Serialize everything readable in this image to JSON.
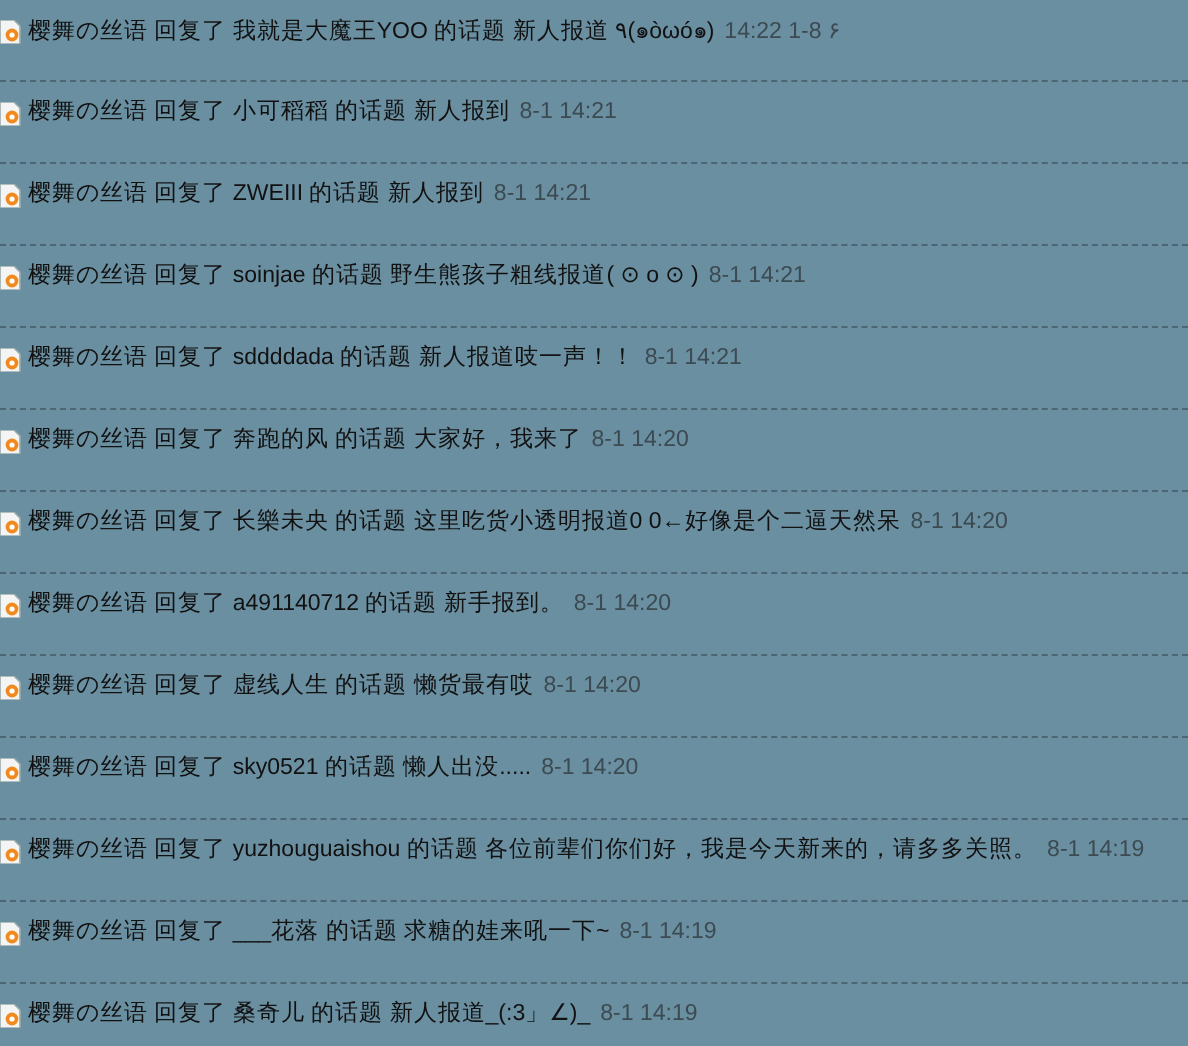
{
  "activities": [
    {
      "user": "樱舞の丝语",
      "verb": "回复了",
      "author": "我就是大魔王YOO",
      "of_topic": "的话题",
      "topic": "新人报道 ٩(๑òωó๑)",
      "time": "14:22 1-8 ۶"
    },
    {
      "user": "樱舞の丝语",
      "verb": "回复了",
      "author": "小可稻稻",
      "of_topic": "的话题",
      "topic": "新人报到",
      "time": "8-1 14:21"
    },
    {
      "user": "樱舞の丝语",
      "verb": "回复了",
      "author": "ZWEIII",
      "of_topic": "的话题",
      "topic": "新人报到",
      "time": "8-1 14:21"
    },
    {
      "user": "樱舞の丝语",
      "verb": "回复了",
      "author": "soinjae",
      "of_topic": "的话题",
      "topic": "野生熊孩子粗线报道( ⊙ o ⊙ )",
      "time": "8-1 14:21"
    },
    {
      "user": "樱舞の丝语",
      "verb": "回复了",
      "author": "sddddada",
      "of_topic": "的话题",
      "topic": "新人报道吱一声！！",
      "time": "8-1 14:21"
    },
    {
      "user": "樱舞の丝语",
      "verb": "回复了",
      "author": "奔跑的风",
      "of_topic": "的话题",
      "topic": "大家好，我来了",
      "time": "8-1 14:20"
    },
    {
      "user": "樱舞の丝语",
      "verb": "回复了",
      "author": "长樂未央",
      "of_topic": "的话题",
      "topic": "这里吃货小透明报道0 0←好像是个二逼天然呆",
      "time": "8-1 14:20"
    },
    {
      "user": "樱舞の丝语",
      "verb": "回复了",
      "author": "a491140712",
      "of_topic": "的话题",
      "topic": "新手报到。",
      "time": "8-1 14:20"
    },
    {
      "user": "樱舞の丝语",
      "verb": "回复了",
      "author": "虚线人生",
      "of_topic": "的话题",
      "topic": "懒货最有哎",
      "time": "8-1 14:20"
    },
    {
      "user": "樱舞の丝语",
      "verb": "回复了",
      "author": "sky0521",
      "of_topic": "的话题",
      "topic": "懒人出没.....",
      "time": "8-1 14:20"
    },
    {
      "user": "樱舞の丝语",
      "verb": "回复了",
      "author": "yuzhouguaishou",
      "of_topic": "的话题",
      "topic": "各位前辈们你们好，我是今天新来的，请多多关照。",
      "time": "8-1 14:19"
    },
    {
      "user": "樱舞の丝语",
      "verb": "回复了",
      "author": "___花落",
      "of_topic": "的话题",
      "topic": "求糖的娃来吼一下~",
      "time": "8-1 14:19"
    },
    {
      "user": "樱舞の丝语",
      "verb": "回复了",
      "author": "桑奇儿",
      "of_topic": "的话题",
      "topic": "新人报道_(:3」∠)_",
      "time": "8-1 14:19"
    }
  ]
}
